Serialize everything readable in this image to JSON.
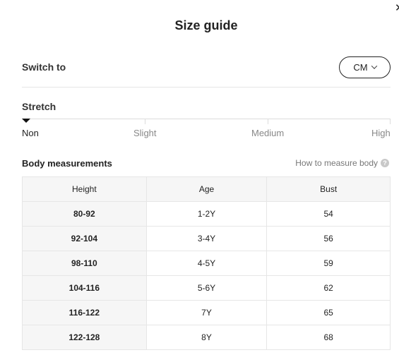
{
  "dialog": {
    "title": "Size guide",
    "close_icon": "close-icon"
  },
  "switch": {
    "label": "Switch to",
    "unit": "CM"
  },
  "stretch": {
    "title": "Stretch",
    "levels": [
      "Non",
      "Slight",
      "Medium",
      "High"
    ],
    "selected": "Non"
  },
  "body_measurements": {
    "title": "Body measurements",
    "how_to_link": "How to measure body",
    "help_icon": "question-icon",
    "headers": [
      "Height",
      "Age",
      "Bust"
    ],
    "rows": [
      [
        "80-92",
        "1-2Y",
        "54"
      ],
      [
        "92-104",
        "3-4Y",
        "56"
      ],
      [
        "98-110",
        "4-5Y",
        "59"
      ],
      [
        "104-116",
        "5-6Y",
        "62"
      ],
      [
        "116-122",
        "7Y",
        "65"
      ],
      [
        "122-128",
        "8Y",
        "68"
      ]
    ]
  }
}
